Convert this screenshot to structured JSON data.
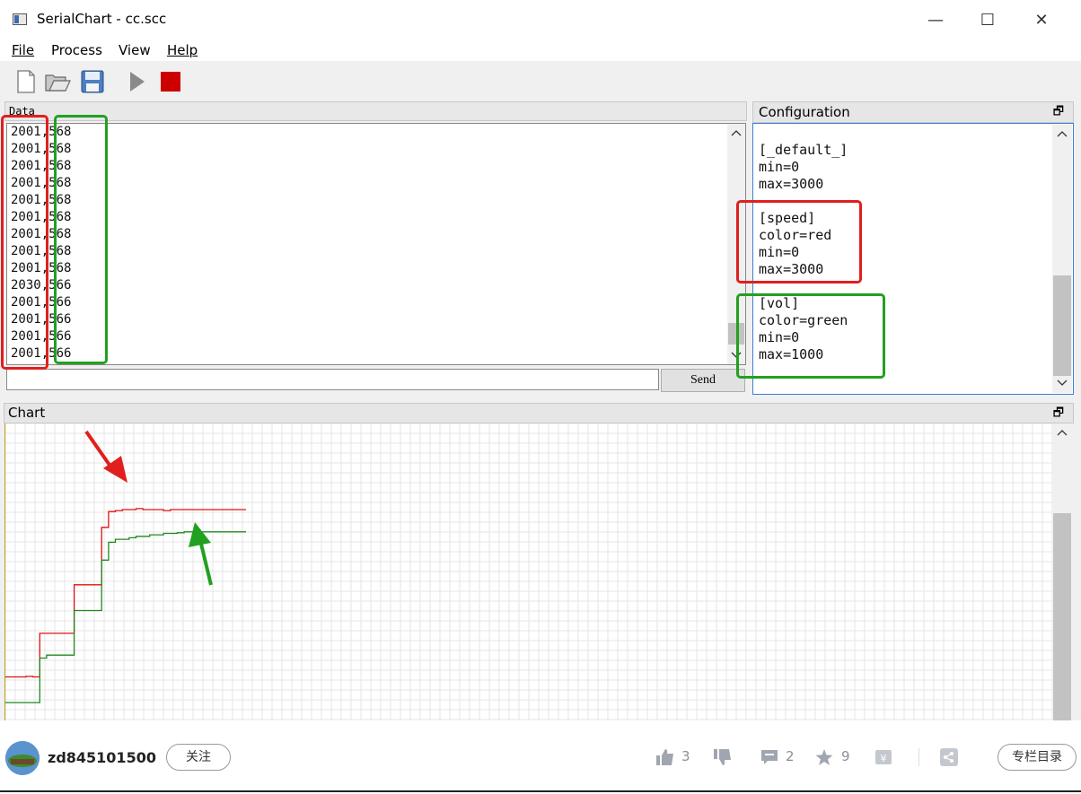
{
  "window": {
    "title": "SerialChart - cc.scc",
    "minimize": "—",
    "maximize": "☐",
    "close": "✕"
  },
  "menu": [
    "File",
    "Process",
    "View",
    "Help"
  ],
  "toolbar": {
    "icons": [
      "new-file-icon",
      "open-folder-icon",
      "save-icon",
      "run-icon",
      "stop-icon"
    ]
  },
  "data_panel": {
    "title": "Data",
    "lines": [
      "2001,568",
      "2001,568",
      "2001,568",
      "2001,568",
      "2001,568",
      "2001,568",
      "2001,568",
      "2001,568",
      "2001,568",
      "2030,566",
      "2001,566",
      "2001,566",
      "2001,566",
      "2001,566"
    ],
    "send_label": "Send",
    "send_value": ""
  },
  "config_panel": {
    "title": "Configuration",
    "lines": [
      "[_default_]",
      "min=0",
      "max=3000",
      "",
      "[speed]",
      "color=red",
      "min=0",
      "max=3000",
      "",
      "[vol]",
      "color=green",
      "min=0",
      "max=1000"
    ]
  },
  "chart_panel": {
    "title": "Chart"
  },
  "chart_data": {
    "type": "line",
    "x": [
      0,
      1,
      2,
      3,
      4,
      5,
      6,
      7,
      8,
      9,
      10,
      11,
      12,
      13,
      14,
      15,
      16,
      17,
      18,
      19,
      20,
      21,
      22,
      23,
      24,
      25,
      26,
      27,
      28,
      29,
      30,
      31,
      32,
      33,
      34,
      35
    ],
    "series": [
      {
        "name": "speed",
        "color": "red",
        "min": 0,
        "max": 3000,
        "values": [
          440,
          440,
          440,
          445,
          440,
          880,
          880,
          880,
          880,
          880,
          1370,
          1370,
          1370,
          1370,
          1950,
          2110,
          2120,
          2130,
          2130,
          2140,
          2130,
          2130,
          2130,
          2120,
          2130,
          2130,
          2130,
          2130,
          2130,
          2130,
          2130,
          2130,
          2130,
          2130,
          2130,
          2130
        ]
      },
      {
        "name": "vol",
        "color": "green",
        "min": 0,
        "max": 1000,
        "values": [
          60,
          60,
          60,
          60,
          60,
          210,
          220,
          220,
          220,
          220,
          370,
          370,
          370,
          370,
          540,
          600,
          610,
          610,
          615,
          620,
          620,
          625,
          625,
          630,
          630,
          632,
          635,
          635,
          635,
          635,
          635,
          635,
          635,
          635,
          635,
          635
        ]
      }
    ]
  },
  "footer": {
    "username": "zd845101500",
    "follow_label": "关注",
    "like_count": "3",
    "comment_count": "2",
    "favorite_count": "9",
    "column_label": "专栏目录"
  }
}
